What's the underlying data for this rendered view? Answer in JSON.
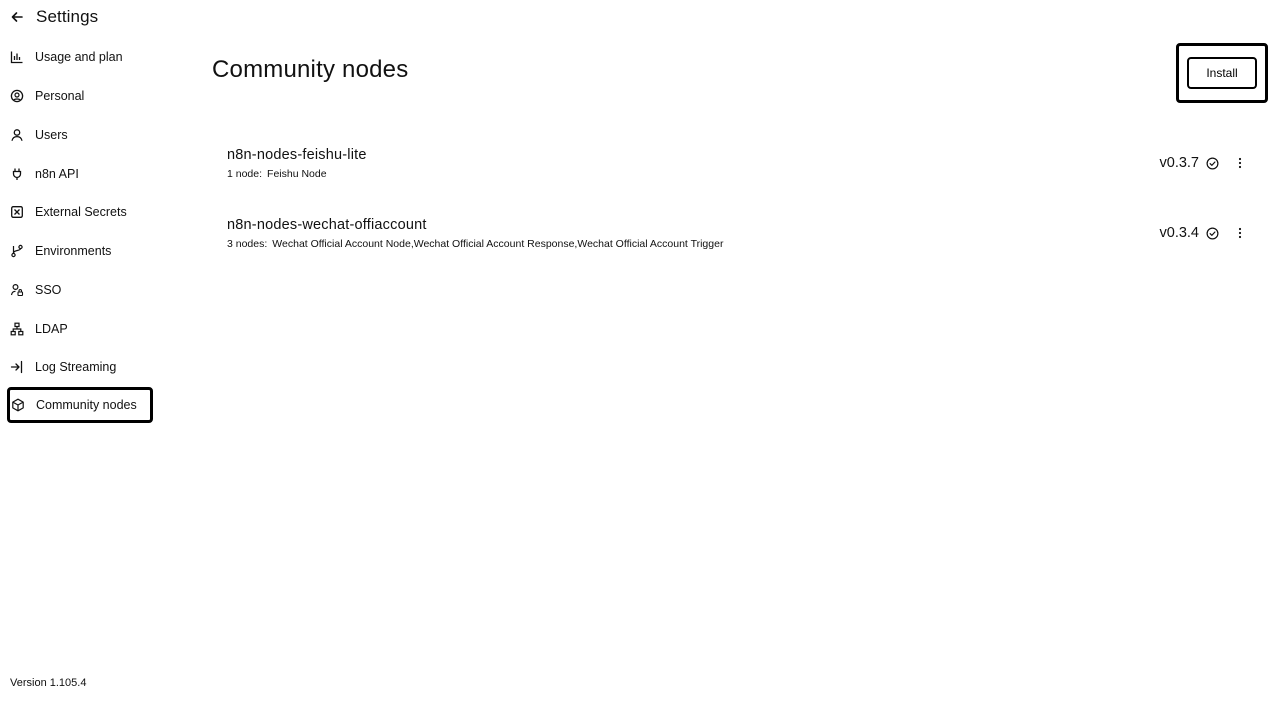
{
  "sidebar": {
    "title": "Settings",
    "items": [
      {
        "label": "Usage and plan",
        "icon": "chart-bar-icon"
      },
      {
        "label": "Personal",
        "icon": "user-circle-icon"
      },
      {
        "label": "Users",
        "icon": "user-icon"
      },
      {
        "label": "n8n API",
        "icon": "plug-icon"
      },
      {
        "label": "External Secrets",
        "icon": "vault-icon"
      },
      {
        "label": "Environments",
        "icon": "git-branch-icon"
      },
      {
        "label": "SSO",
        "icon": "user-lock-icon"
      },
      {
        "label": "LDAP",
        "icon": "network-icon"
      },
      {
        "label": "Log Streaming",
        "icon": "sign-in-icon"
      },
      {
        "label": "Community nodes",
        "icon": "cube-icon",
        "active": true
      }
    ],
    "version": "Version 1.105.4"
  },
  "main": {
    "title": "Community nodes",
    "install_label": "Install",
    "packages": [
      {
        "name": "n8n-nodes-feishu-lite",
        "count": "1 node:",
        "nodes": "Feishu Node",
        "version": "v0.3.7"
      },
      {
        "name": "n8n-nodes-wechat-offiaccount",
        "count": "3 nodes:",
        "nodes": "Wechat Official Account Node,Wechat Official Account Response,Wechat Official Account Trigger",
        "version": "v0.3.4"
      }
    ]
  }
}
